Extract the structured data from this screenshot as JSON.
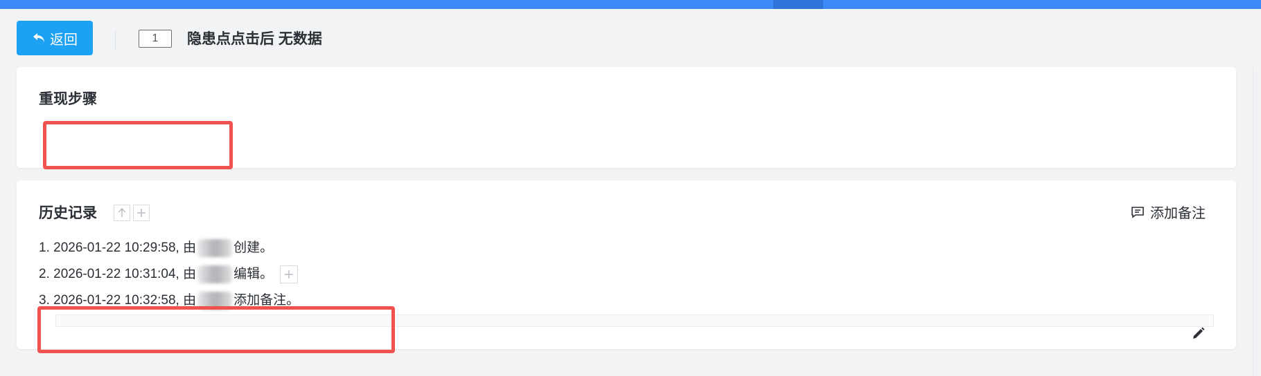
{
  "header": {
    "back_label": "返回",
    "issue_id": "1",
    "issue_title": "隐患点点击后 无数据"
  },
  "repro": {
    "title": "重现步骤"
  },
  "history": {
    "title": "历史记录",
    "add_note_label": "添加备注",
    "entries": [
      {
        "prefix": "1. 2026-01-22 10:29:58, 由",
        "suffix": "创建。"
      },
      {
        "prefix": "2. 2026-01-22 10:31:04, 由",
        "suffix": "编辑。"
      },
      {
        "prefix": "3. 2026-01-22 10:32:58, 由",
        "suffix": "添加备注。"
      }
    ]
  },
  "colors": {
    "accent": "#1da1f2",
    "topbar": "#3d8af7",
    "highlight": "#ef5350"
  },
  "icons": [
    "back-arrow-icon",
    "arrow-up-icon",
    "plus-icon",
    "comment-icon",
    "pencil-icon"
  ]
}
